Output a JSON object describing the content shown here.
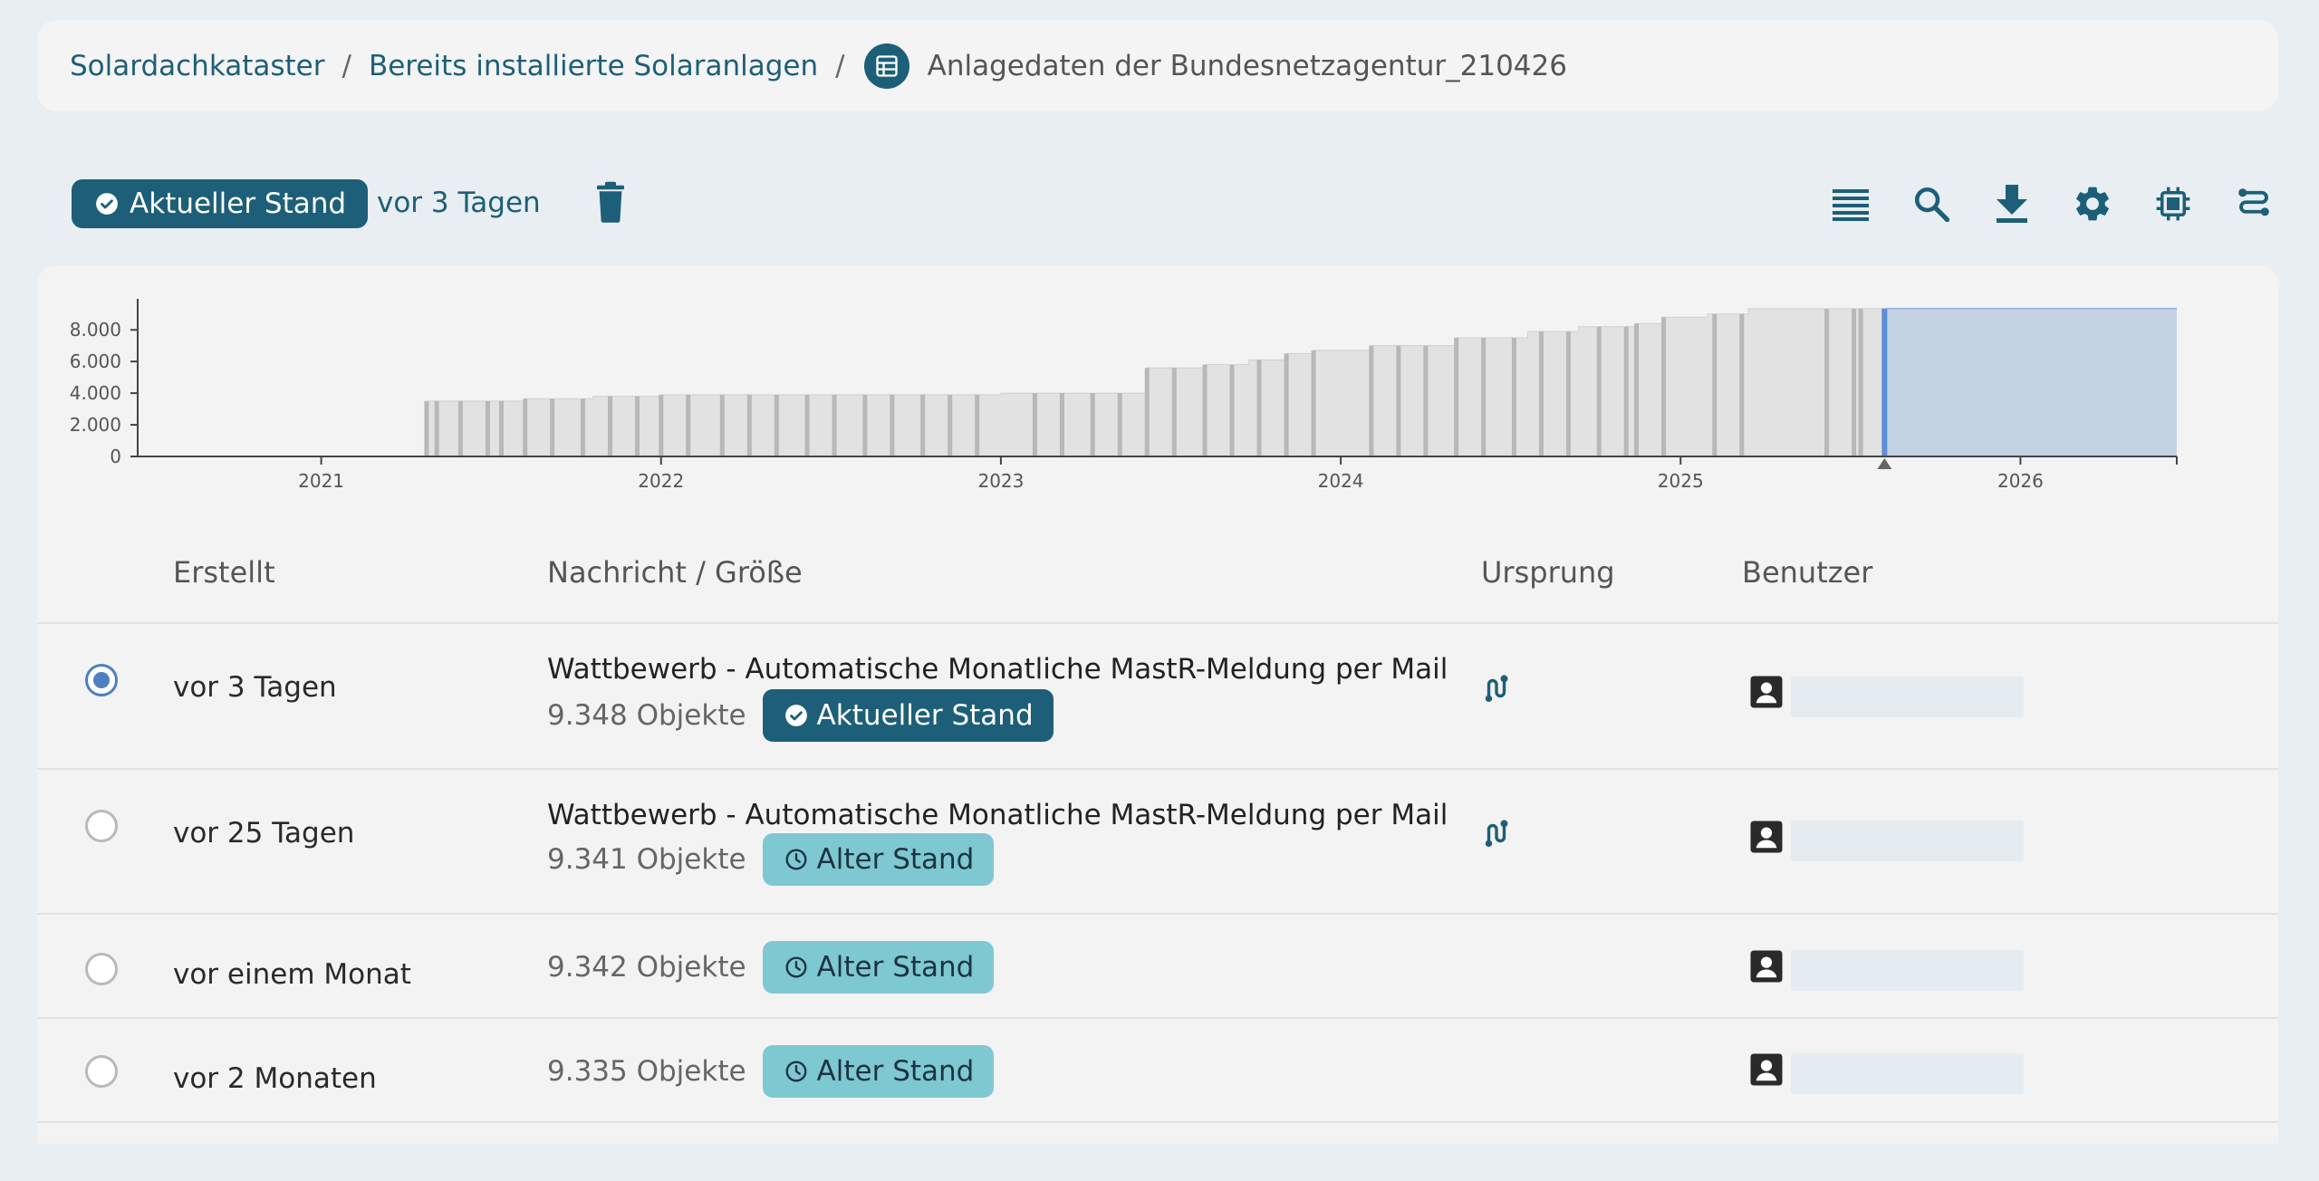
{
  "breadcrumb": {
    "items": [
      "Solardachkataster",
      "Bereits installierte Solaranlagen"
    ],
    "separator": "/",
    "current": "Anlagedaten der Bundesnetzagentur_210426"
  },
  "toolbar": {
    "status_label": "Aktueller Stand",
    "age_text": "vor 3 Tagen",
    "icons": [
      "list-icon",
      "search-icon",
      "download-icon",
      "gear-icon",
      "chip-icon",
      "route-icon"
    ]
  },
  "colors": {
    "accent": "#1d5f78",
    "old_tag": "#7ec8d2",
    "timeline_fill": "#e2e2e2",
    "timeline_marker": "#b8b8b8",
    "future_fill": "#c4d3e3",
    "current_line": "#5b8fd9"
  },
  "chart_data": {
    "type": "area",
    "x_unit": "year",
    "y_ticks": [
      "0",
      "2.000",
      "4.000",
      "6.000",
      "8.000"
    ],
    "x_ticks": [
      "2021",
      "2022",
      "2023",
      "2024",
      "2025",
      "2026"
    ],
    "ylim": [
      0,
      9500
    ],
    "xlim": [
      2020.46,
      2026.46
    ],
    "current_x": 2025.6,
    "current_y": 9348,
    "steps": [
      [
        2021.31,
        3500
      ],
      [
        2021.6,
        3650
      ],
      [
        2021.8,
        3800
      ],
      [
        2022.0,
        3900
      ],
      [
        2023.0,
        4000
      ],
      [
        2023.43,
        5600
      ],
      [
        2023.6,
        5800
      ],
      [
        2023.73,
        6100
      ],
      [
        2023.84,
        6500
      ],
      [
        2023.92,
        6700
      ],
      [
        2024.09,
        7000
      ],
      [
        2024.34,
        7500
      ],
      [
        2024.55,
        7900
      ],
      [
        2024.7,
        8200
      ],
      [
        2024.87,
        8400
      ],
      [
        2024.95,
        8800
      ],
      [
        2025.08,
        9000
      ],
      [
        2025.2,
        9335
      ],
      [
        2025.52,
        9342
      ],
      [
        2025.55,
        9341
      ],
      [
        2025.6,
        9348
      ]
    ],
    "markers": [
      2021.31,
      2021.34,
      2021.41,
      2021.49,
      2021.53,
      2021.6,
      2021.68,
      2021.77,
      2021.85,
      2021.93,
      2022.0,
      2022.08,
      2022.18,
      2022.26,
      2022.34,
      2022.43,
      2022.51,
      2022.6,
      2022.68,
      2022.77,
      2022.85,
      2022.93,
      2023.1,
      2023.18,
      2023.27,
      2023.35,
      2023.43,
      2023.51,
      2023.6,
      2023.68,
      2023.76,
      2023.84,
      2023.92,
      2024.09,
      2024.17,
      2024.25,
      2024.34,
      2024.42,
      2024.51,
      2024.59,
      2024.67,
      2024.76,
      2024.84,
      2024.87,
      2024.95,
      2025.1,
      2025.18,
      2025.43,
      2025.51,
      2025.53
    ]
  },
  "table": {
    "headers": [
      "Erstellt",
      "Nachricht / Größe",
      "Ursprung",
      "Benutzer"
    ],
    "rows": [
      {
        "selected": true,
        "created": "vor 3 Tagen",
        "message": "Wattbewerb - Automatische Monatliche MastR-Meldung per Mail",
        "size": "9.348 Objekte",
        "tag": "Aktueller Stand",
        "tag_kind": "current",
        "origin_icon": "route-icon"
      },
      {
        "selected": false,
        "created": "vor 25 Tagen",
        "message": "Wattbewerb - Automatische Monatliche MastR-Meldung per Mail",
        "size": "9.341 Objekte",
        "tag": "Alter Stand",
        "tag_kind": "old",
        "origin_icon": "route-icon"
      },
      {
        "selected": false,
        "created": "vor einem Monat",
        "message": "",
        "size": "9.342 Objekte",
        "tag": "Alter Stand",
        "tag_kind": "old",
        "origin_icon": ""
      },
      {
        "selected": false,
        "created": "vor 2 Monaten",
        "message": "",
        "size": "9.335 Objekte",
        "tag": "Alter Stand",
        "tag_kind": "old",
        "origin_icon": ""
      }
    ]
  }
}
